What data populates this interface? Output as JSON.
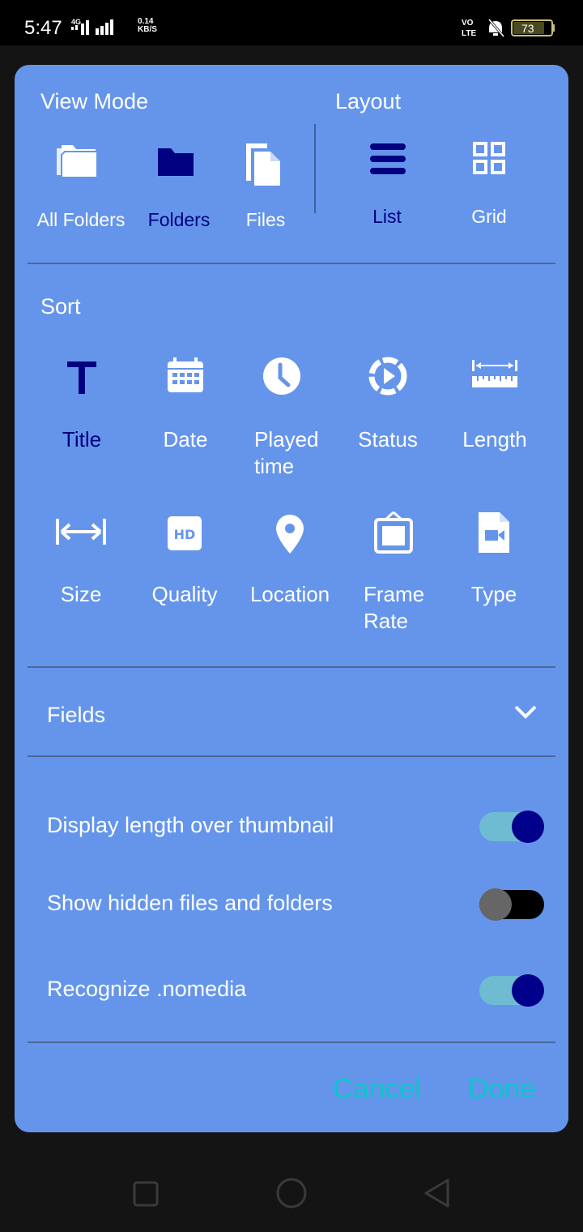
{
  "status_bar": {
    "time": "5:47",
    "network_type": "4G",
    "speed_value": "0.14",
    "speed_unit": "KB/S",
    "volte": "VO LTE",
    "battery": "73"
  },
  "dialog": {
    "view_mode": {
      "title": "View Mode",
      "items": [
        {
          "label": "All Folders",
          "icon": "folder-multiple-icon"
        },
        {
          "label": "Folders",
          "icon": "folder-icon",
          "selected": true
        },
        {
          "label": "Files",
          "icon": "file-multiple-icon"
        }
      ]
    },
    "layout": {
      "title": "Layout",
      "items": [
        {
          "label": "List",
          "icon": "list-icon",
          "selected": true
        },
        {
          "label": "Grid",
          "icon": "grid-icon"
        }
      ]
    },
    "sort": {
      "title": "Sort",
      "items": [
        {
          "label": "Title",
          "icon": "title-icon",
          "selected": true
        },
        {
          "label": "Date",
          "icon": "calendar-icon"
        },
        {
          "label": "Played\ntime",
          "icon": "clock-icon"
        },
        {
          "label": "Status",
          "icon": "play-status-icon"
        },
        {
          "label": "Length",
          "icon": "ruler-icon"
        },
        {
          "label": "Size",
          "icon": "width-arrows-icon"
        },
        {
          "label": "Quality",
          "icon": "hd-icon"
        },
        {
          "label": "Location",
          "icon": "location-pin-icon"
        },
        {
          "label": "Frame\nRate",
          "icon": "frame-icon"
        },
        {
          "label": "Type",
          "icon": "video-file-icon"
        }
      ]
    },
    "fields": {
      "label": "Fields",
      "icon": "chevron-down-icon"
    },
    "toggles": [
      {
        "label": "Display length over thumbnail",
        "on": true
      },
      {
        "label": "Show hidden files and folders",
        "on": false
      },
      {
        "label": "Recognize .nomedia",
        "on": true
      }
    ],
    "buttons": {
      "cancel": "Cancel",
      "done": "Done"
    }
  },
  "colors": {
    "dialog_bg": "#6595EB",
    "selected": "#000080",
    "button_text": "#0FC3CD",
    "toggle_on_track": "#6FBCD2",
    "toggle_on_knob": "#00008B",
    "toggle_off_track": "#000000",
    "toggle_off_knob": "#666666"
  },
  "nav_bar": {
    "recents": "square-icon",
    "home": "circle-icon",
    "back": "triangle-back-icon"
  }
}
